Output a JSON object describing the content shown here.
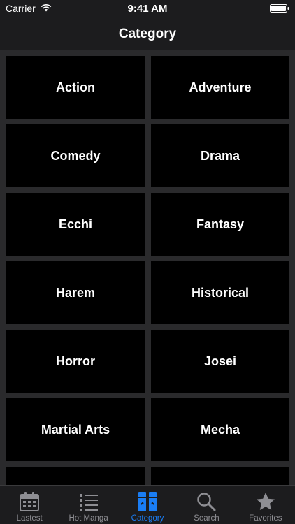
{
  "status": {
    "carrier": "Carrier",
    "time": "9:41 AM"
  },
  "nav": {
    "title": "Category"
  },
  "categories": [
    "Action",
    "Adventure",
    "Comedy",
    "Drama",
    "Ecchi",
    "Fantasy",
    "Harem",
    "Historical",
    "Horror",
    "Josei",
    "Martial Arts",
    "Mecha"
  ],
  "tabs": [
    {
      "label": "Lastest",
      "icon": "calendar-icon"
    },
    {
      "label": "Hot Manga",
      "icon": "list-icon"
    },
    {
      "label": "Category",
      "icon": "category-icon"
    },
    {
      "label": "Search",
      "icon": "search-icon"
    },
    {
      "label": "Favorites",
      "icon": "star-icon"
    }
  ],
  "colors": {
    "active_tab": "#1a7df4",
    "inactive_tab": "#8e8e93",
    "tile": "#000000",
    "background": "#232325"
  }
}
